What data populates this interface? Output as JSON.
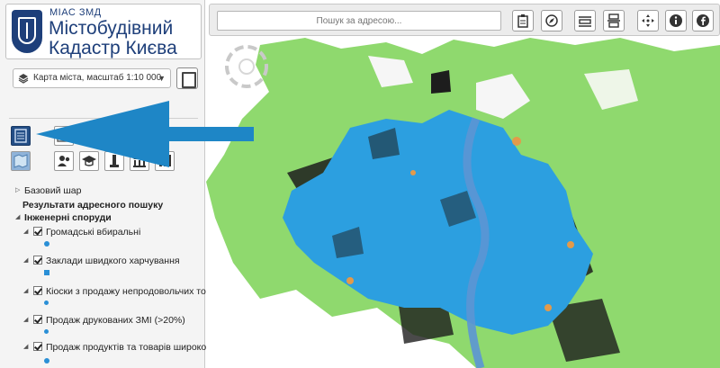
{
  "logo": {
    "top_line": "МІАС ЗМД",
    "title_line1": "Містобудівний",
    "title_line2": "Кадастр Києва"
  },
  "basemap": {
    "selected": "Карта міста, масштаб 1:10 000"
  },
  "search": {
    "placeholder": "Пошук за адресою..."
  },
  "toolbar": {
    "buttons": [
      "clipboard-icon",
      "compass-icon",
      "ruler-icon",
      "layout-icon",
      "pan-icon",
      "info-icon",
      "facebook-icon"
    ]
  },
  "tools": {
    "row1": [
      "calculator-icon",
      "table-icon"
    ],
    "row2": [
      "map-icon",
      "people-icon",
      "education-icon",
      "monument-icon",
      "building-icon",
      "chart-icon"
    ]
  },
  "layers": {
    "base_layer": "Базовий шар",
    "search_results": "Результати адресного пошуку",
    "group": "Інженерні споруди",
    "items": [
      {
        "label": "Громадські вбиральні",
        "checked": true
      },
      {
        "label": "Заклади швидкого харчування",
        "checked": true
      },
      {
        "label": "Кіоски з продажу непродовольчих товарів",
        "checked": true
      },
      {
        "label": "Продаж друкованих ЗМІ (>20%)",
        "checked": true
      },
      {
        "label": "Продаж продуктів та товарів широкого",
        "checked": true
      }
    ]
  },
  "colors": {
    "map_green": "#8fd96e",
    "map_blue": "#2c9fe0",
    "map_dark": "#1d1d1d",
    "map_orange": "#e39a4a",
    "river": "#5c95d4",
    "arrow": "#1e86c6",
    "brand_navy": "#1e3f7a"
  }
}
